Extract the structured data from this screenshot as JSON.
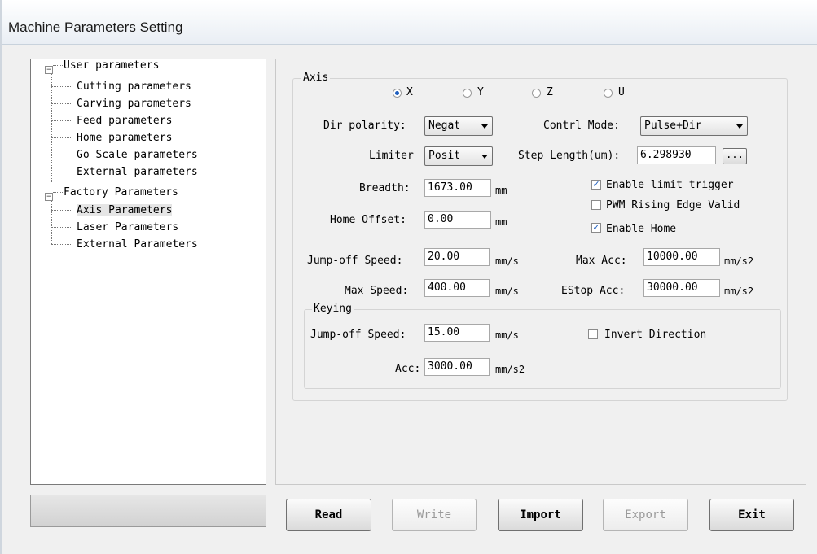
{
  "window": {
    "title": "Machine Parameters Setting"
  },
  "tree": {
    "user_parameters": "User parameters",
    "cutting": "Cutting parameters",
    "carving": "Carving parameters",
    "feed": "Feed parameters",
    "home": "Home parameters",
    "go_scale": "Go Scale parameters",
    "external_user": "External parameters",
    "factory_parameters": "Factory Parameters",
    "axis": "Axis Parameters",
    "laser": "Laser Parameters",
    "external_factory": "External Parameters",
    "selected": "Axis Parameters"
  },
  "axis": {
    "group_label": "Axis",
    "radio_x": "X",
    "radio_y": "Y",
    "radio_z": "Z",
    "radio_u": "U",
    "selected_axis": "X",
    "dir_polarity_label": "Dir polarity:",
    "dir_polarity_value": "Negat",
    "contrl_mode_label": "Contrl Mode:",
    "contrl_mode_value": "Pulse+Dir",
    "limiter_label": "Limiter",
    "limiter_value": "Posit",
    "step_length_label": "Step Length(um):",
    "step_length_value": "6.298930",
    "browse_label": "...",
    "breadth_label": "Breadth:",
    "breadth_value": "1673.00",
    "breadth_unit": "mm",
    "enable_limit_trigger": "Enable limit trigger",
    "enable_limit_trigger_checked": true,
    "pwm_rising_edge": "PWM Rising Edge Valid",
    "pwm_rising_edge_checked": false,
    "home_offset_label": "Home Offset:",
    "home_offset_value": "0.00",
    "home_offset_unit": "mm",
    "enable_home": "Enable Home",
    "enable_home_checked": true,
    "jump_off_speed_label": "Jump-off Speed:",
    "jump_off_speed_value": "20.00",
    "jump_off_speed_unit": "mm/s",
    "max_acc_label": "Max Acc:",
    "max_acc_value": "10000.00",
    "max_acc_unit": "mm/s2",
    "max_speed_label": "Max Speed:",
    "max_speed_value": "400.00",
    "max_speed_unit": "mm/s",
    "estop_acc_label": "EStop Acc:",
    "estop_acc_value": "30000.00",
    "estop_acc_unit": "mm/s2"
  },
  "keying": {
    "group_label": "Keying",
    "jump_off_speed_label": "Jump-off Speed:",
    "jump_off_speed_value": "15.00",
    "jump_off_speed_unit": "mm/s",
    "invert_direction": "Invert Direction",
    "invert_direction_checked": false,
    "acc_label": "Acc:",
    "acc_value": "3000.00",
    "acc_unit": "mm/s2"
  },
  "buttons": {
    "read": "Read",
    "write": "Write",
    "import": "Import",
    "export": "Export",
    "exit": "Exit"
  },
  "colors": {
    "accent": "#1f5fbf",
    "window_bg": "#f0f0f0"
  }
}
